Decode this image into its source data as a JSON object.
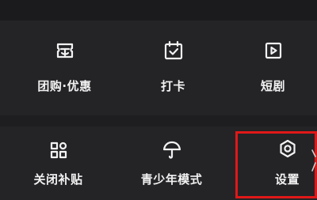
{
  "grid": {
    "row1": [
      {
        "label": "团购·优惠",
        "icon": "group-buy-tag-icon"
      },
      {
        "label": "打卡",
        "icon": "calendar-check-icon"
      },
      {
        "label": "短剧",
        "icon": "play-video-icon"
      }
    ],
    "row2": [
      {
        "label": "关闭补贴",
        "icon": "grid-apps-icon"
      },
      {
        "label": "青少年模式",
        "icon": "umbrella-icon"
      },
      {
        "label": "设置",
        "icon": "gear-hexagon-icon"
      }
    ]
  },
  "highlight": {
    "color": "#e01818",
    "target": "设置"
  },
  "colors": {
    "background": "#1e1e21",
    "card": "#242427",
    "text": "#f2f2f2"
  }
}
